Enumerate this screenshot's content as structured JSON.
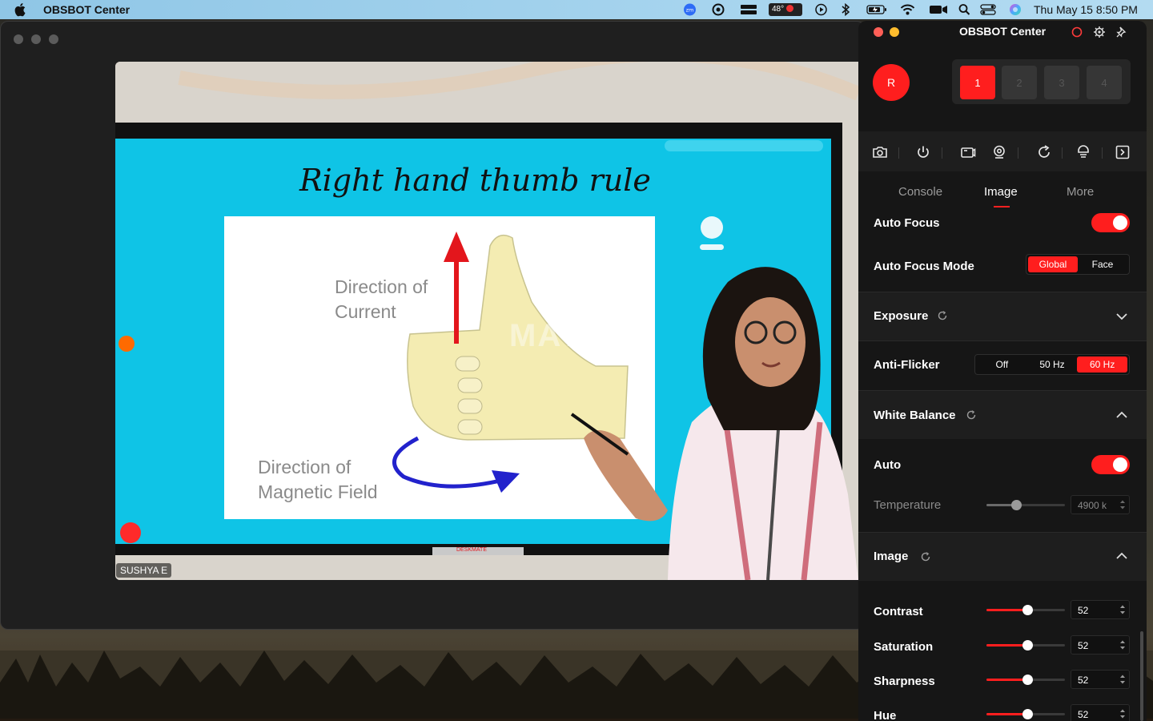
{
  "menubar": {
    "app_name": "OBSBOT Center",
    "weather": "48°",
    "clock": "Thu May 15  8:50 PM"
  },
  "meeting": {
    "participant_name": "SUSHYA E",
    "board": {
      "title": "Right hand thumb rule",
      "label_current": [
        "Direction of",
        "Current"
      ],
      "label_field": [
        "Direction of",
        "Magnetic Field"
      ],
      "watermark": "MATE",
      "bezel_brand": "DESKMATE"
    }
  },
  "panel": {
    "title": "OBSBOT Center",
    "record_label": "R",
    "slots": [
      "1",
      "2",
      "3",
      "4"
    ],
    "active_slot": 0,
    "tabs": [
      "Console",
      "Image",
      "More"
    ],
    "active_tab": 1,
    "auto_focus": {
      "label": "Auto Focus",
      "on": true
    },
    "auto_focus_mode": {
      "label": "Auto Focus Mode",
      "options": [
        "Global",
        "Face"
      ],
      "selected": 0
    },
    "exposure": {
      "label": "Exposure"
    },
    "anti_flicker": {
      "label": "Anti-Flicker",
      "options": [
        "Off",
        "50 Hz",
        "60 Hz"
      ],
      "selected": 2
    },
    "white_balance": {
      "label": "White Balance",
      "auto_label": "Auto",
      "auto_on": true,
      "temperature_label": "Temperature",
      "temperature_value": "4900 k",
      "temperature_level": 0.38
    },
    "image": {
      "label": "Image",
      "controls": [
        {
          "label": "Contrast",
          "value": "52",
          "level": 0.52
        },
        {
          "label": "Saturation",
          "value": "52",
          "level": 0.52
        },
        {
          "label": "Sharpness",
          "value": "52",
          "level": 0.52
        },
        {
          "label": "Hue",
          "value": "52",
          "level": 0.52
        }
      ]
    },
    "colors": {
      "accent": "#ff1e1e",
      "panel_bg": "#161616",
      "section_bg": "#1e1e1e"
    }
  }
}
